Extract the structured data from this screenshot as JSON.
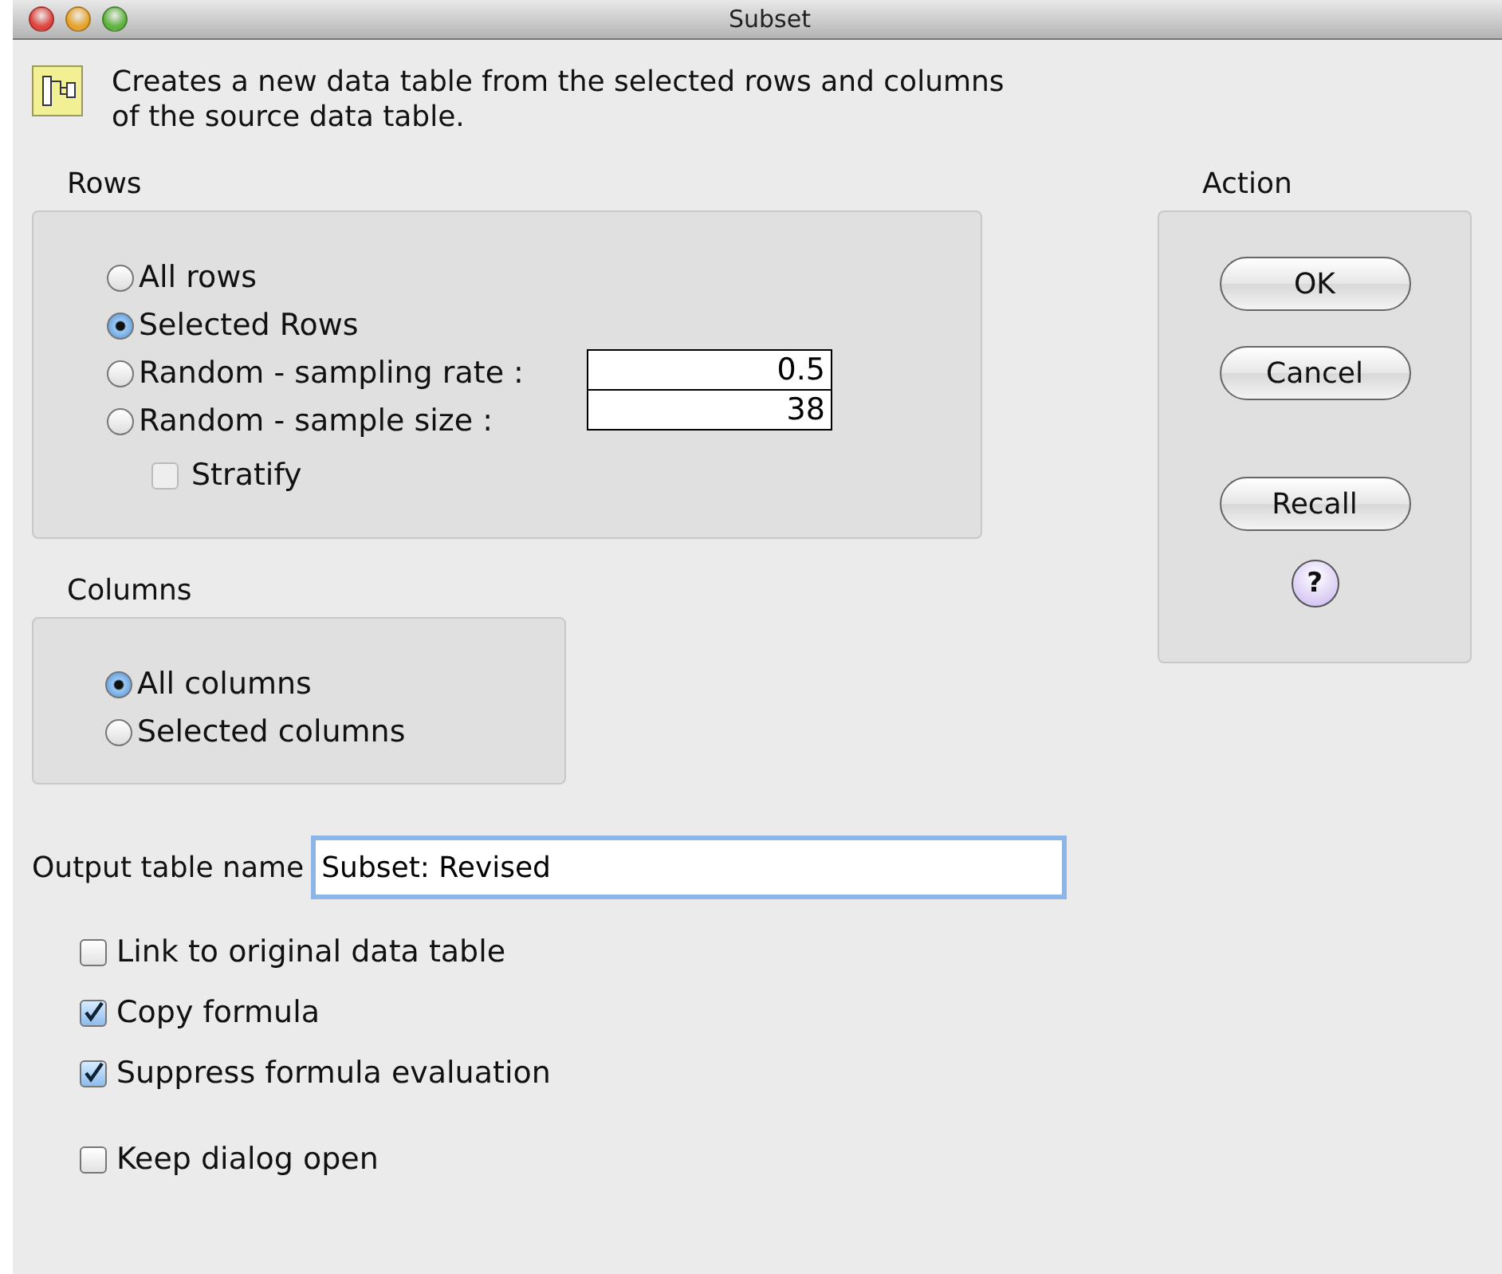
{
  "window": {
    "title": "Subset"
  },
  "intro": "Creates a new data table from the selected rows and columns of the source data table.",
  "rows": {
    "label": "Rows",
    "options": [
      {
        "label": "All rows",
        "selected": false
      },
      {
        "label": "Selected Rows",
        "selected": true
      },
      {
        "label": "Random - sampling rate :",
        "selected": false,
        "value": "0.5"
      },
      {
        "label": "Random - sample size :",
        "selected": false,
        "value": "38"
      }
    ],
    "stratify": {
      "label": "Stratify",
      "checked": false,
      "disabled": true
    }
  },
  "columns": {
    "label": "Columns",
    "options": [
      {
        "label": "All columns",
        "selected": true
      },
      {
        "label": "Selected columns",
        "selected": false
      }
    ]
  },
  "action": {
    "label": "Action",
    "buttons": [
      "OK",
      "Cancel",
      "Recall"
    ],
    "help": "?"
  },
  "output": {
    "label": "Output table name",
    "value": "Subset: Revised"
  },
  "options": [
    {
      "label": "Link to original data table",
      "checked": false
    },
    {
      "label": "Copy formula",
      "checked": true
    },
    {
      "label": "Suppress formula evaluation",
      "checked": true
    },
    {
      "label": "Keep dialog open",
      "checked": false
    }
  ]
}
